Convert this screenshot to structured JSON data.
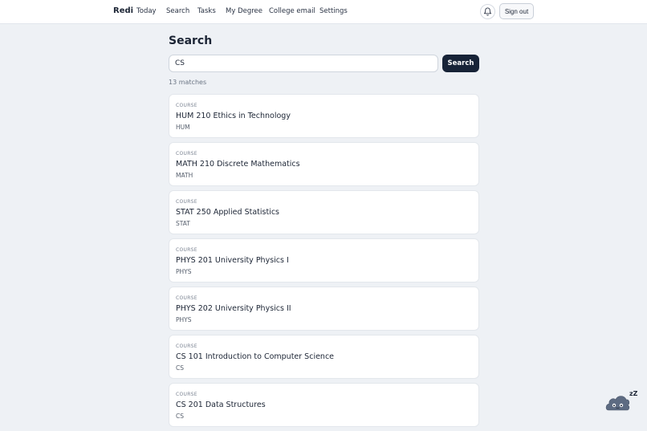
{
  "app": {
    "brand": "Redi"
  },
  "nav": {
    "items": [
      {
        "label": "Today"
      },
      {
        "label": "Search"
      },
      {
        "label": "Tasks"
      },
      {
        "label": "My Degree"
      },
      {
        "label": "College email"
      },
      {
        "label": "Settings"
      }
    ],
    "sign_out_label": "Sign out"
  },
  "page": {
    "title": "Search"
  },
  "search": {
    "value": "CS",
    "button_label": "Search"
  },
  "results": {
    "count_text": "13 matches",
    "items": [
      {
        "kind": "COURSE",
        "title": "HUM 210 Ethics in Technology",
        "subject": "HUM"
      },
      {
        "kind": "COURSE",
        "title": "MATH 210 Discrete Mathematics",
        "subject": "MATH"
      },
      {
        "kind": "COURSE",
        "title": "STAT 250 Applied Statistics",
        "subject": "STAT"
      },
      {
        "kind": "COURSE",
        "title": "PHYS 201 University Physics I",
        "subject": "PHYS"
      },
      {
        "kind": "COURSE",
        "title": "PHYS 202 University Physics II",
        "subject": "PHYS"
      },
      {
        "kind": "COURSE",
        "title": "CS 101 Introduction to Computer Science",
        "subject": "CS"
      },
      {
        "kind": "COURSE",
        "title": "CS 201 Data Structures",
        "subject": "CS"
      }
    ]
  },
  "mascot": {
    "icon": "sleeping-cloud-icon",
    "sleep_text": "zZ"
  },
  "colors": {
    "primary": "#172337",
    "background": "#eef1f5",
    "card": "#ffffff"
  }
}
